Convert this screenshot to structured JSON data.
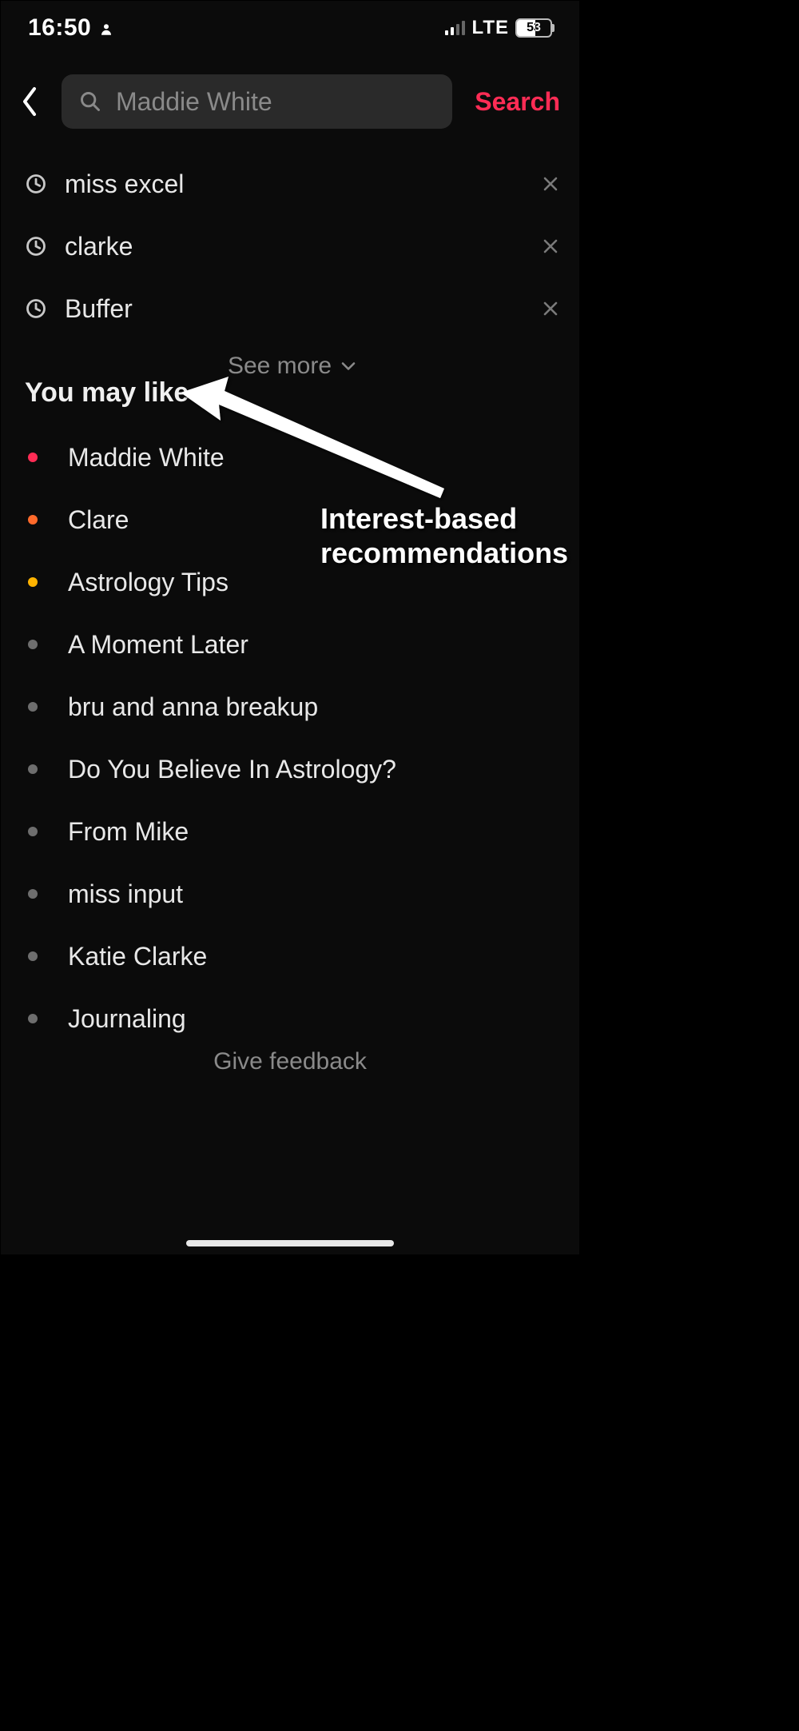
{
  "status": {
    "time": "16:50",
    "carrier_label": "LTE",
    "battery_percent": "53"
  },
  "header": {
    "search_value": "Maddie White",
    "search_action": "Search"
  },
  "recent": {
    "items": [
      {
        "label": "miss excel"
      },
      {
        "label": "clarke"
      },
      {
        "label": "Buffer"
      }
    ],
    "see_more": "See more"
  },
  "you_may_like": {
    "title": "You may like",
    "items": [
      {
        "label": "Maddie White",
        "dot": "#ff2c55"
      },
      {
        "label": "Clare",
        "dot": "#ff6a2b"
      },
      {
        "label": "Astrology Tips",
        "dot": "#ffb300"
      },
      {
        "label": "A Moment Later",
        "dot": "#6e6e6e"
      },
      {
        "label": "bru and anna breakup",
        "dot": "#6e6e6e"
      },
      {
        "label": "Do You Believe In Astrology?",
        "dot": "#6e6e6e"
      },
      {
        "label": "From Mike",
        "dot": "#6e6e6e"
      },
      {
        "label": "miss input",
        "dot": "#6e6e6e"
      },
      {
        "label": "Katie Clarke",
        "dot": "#6e6e6e"
      },
      {
        "label": "Journaling",
        "dot": "#6e6e6e"
      }
    ]
  },
  "footer": {
    "give_feedback": "Give feedback"
  },
  "annotation": {
    "line1": "Interest-based",
    "line2": "recommendations"
  }
}
